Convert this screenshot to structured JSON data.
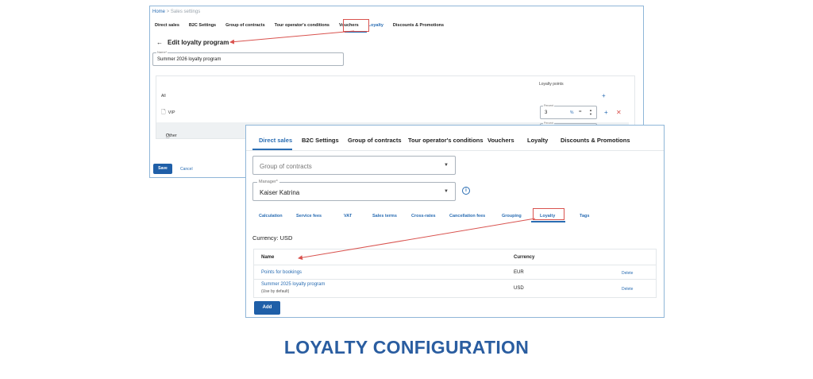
{
  "back_panel": {
    "breadcrumb": {
      "home": "Home",
      "separator": ">",
      "current": "Sales settings"
    },
    "tabs": [
      {
        "label": "Direct sales"
      },
      {
        "label": "B2C Settings"
      },
      {
        "label": "Group of contracts"
      },
      {
        "label": "Tour operator's conditions"
      },
      {
        "label": "Vouchers"
      },
      {
        "label": "Loyalty"
      },
      {
        "label": "Discounts & Promotions"
      }
    ],
    "title": "Edit loyalty program",
    "back_arrow": "←",
    "name_field": {
      "label": "Name*",
      "value": "Summer 2026 loyalty program"
    },
    "loyalty_points_header": "Loyalty points",
    "rows": {
      "all": "All",
      "vip": "VIP",
      "other": "Other"
    },
    "percent_field": {
      "label": "Percent",
      "value": "3",
      "unit": "%",
      "operator": "="
    },
    "save_label": "Save",
    "cancel_label": "Cancel"
  },
  "front_panel": {
    "tabs": [
      {
        "label": "Direct sales"
      },
      {
        "label": "B2C Settings"
      },
      {
        "label": "Group of contracts"
      },
      {
        "label": "Tour operator's conditions"
      },
      {
        "label": "Vouchers"
      },
      {
        "label": "Loyalty"
      },
      {
        "label": "Discounts & Promotions"
      }
    ],
    "group_select": {
      "placeholder": "Group of contracts"
    },
    "manager_select": {
      "label": "Manager*",
      "value": "Kaiser Katrina"
    },
    "subtabs": [
      {
        "label": "Calculation"
      },
      {
        "label": "Service fees"
      },
      {
        "label": "VAT"
      },
      {
        "label": "Sales terms"
      },
      {
        "label": "Cross-rates"
      },
      {
        "label": "Cancellation fees"
      },
      {
        "label": "Grouping"
      },
      {
        "label": "Loyalty"
      },
      {
        "label": "Tags"
      }
    ],
    "currency_text": "Currency: USD",
    "table": {
      "headers": {
        "name": "Name",
        "currency": "Currency"
      },
      "rows": [
        {
          "name": "Points for bookings",
          "sub": "",
          "currency": "EUR",
          "action": "Delete"
        },
        {
          "name": "Summer 2025 loyalty program",
          "sub": "(Use by default)",
          "currency": "USD",
          "action": "Delete"
        }
      ]
    },
    "add_label": "Add"
  },
  "caption": "LOYALTY CONFIGURATION",
  "colors": {
    "accent": "#2a6db3",
    "button": "#1f5fa8",
    "highlight": "#d9534f",
    "caption": "#2a5da0"
  }
}
